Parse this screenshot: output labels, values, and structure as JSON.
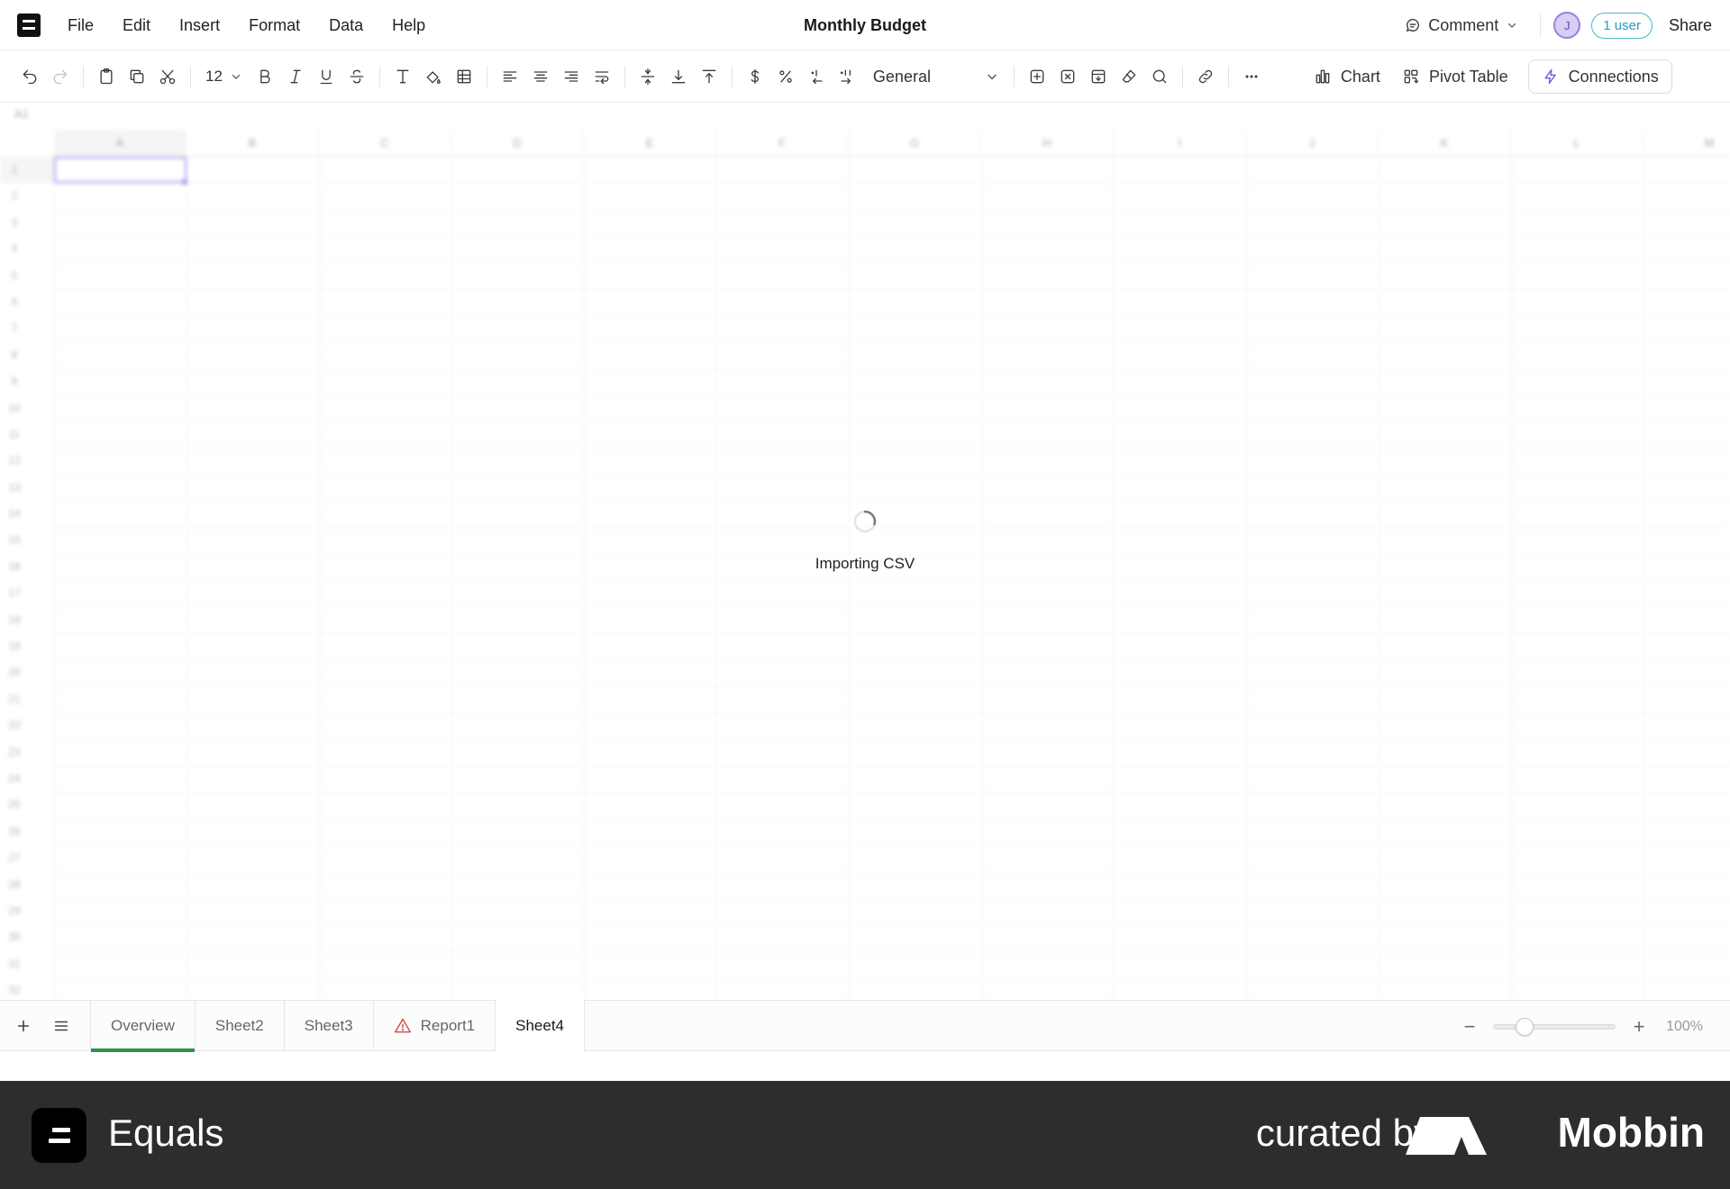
{
  "menubar": {
    "items": [
      "File",
      "Edit",
      "Insert",
      "Format",
      "Data",
      "Help"
    ],
    "doc_title": "Monthly Budget",
    "comment_label": "Comment",
    "avatar_initial": "J",
    "users_label": "1 user",
    "share_label": "Share"
  },
  "toolbar": {
    "font_size": "12",
    "number_format": "General",
    "chart_label": "Chart",
    "pivot_label": "Pivot Table",
    "connections_label": "Connections",
    "icons": [
      "undo-icon",
      "redo-icon",
      "paste-icon",
      "copy-icon",
      "cut-icon",
      "bold-icon",
      "italic-icon",
      "underline-icon",
      "strikethrough-icon",
      "text-color-icon",
      "fill-color-icon",
      "borders-icon",
      "align-left-icon",
      "align-center-icon",
      "align-right-icon",
      "wrap-icon",
      "valign-middle-icon",
      "valign-bottom-icon",
      "valign-top-icon",
      "currency-icon",
      "percent-icon",
      "decrease-decimal-icon",
      "increase-decimal-icon",
      "insert-icon",
      "delete-icon",
      "freeze-icon",
      "eraser-icon",
      "search-icon",
      "link-icon",
      "more-icon"
    ]
  },
  "grid": {
    "cell_ref": "A1",
    "columns": [
      "A",
      "B",
      "C",
      "D",
      "E",
      "F",
      "G",
      "H",
      "I",
      "J",
      "K",
      "L",
      "M"
    ],
    "rows": [
      "1",
      "2",
      "3",
      "4",
      "5",
      "6",
      "7",
      "8",
      "9",
      "10",
      "11",
      "12",
      "13",
      "14",
      "15",
      "16",
      "17",
      "18",
      "19",
      "20",
      "21",
      "22",
      "23",
      "24",
      "25",
      "26",
      "27",
      "28",
      "29",
      "30",
      "31",
      "32"
    ],
    "loading_text": "Importing CSV"
  },
  "sheets": {
    "tabs": [
      {
        "label": "Overview",
        "active": true,
        "warning": false
      },
      {
        "label": "Sheet2",
        "active": false,
        "warning": false
      },
      {
        "label": "Sheet3",
        "active": false,
        "warning": false
      },
      {
        "label": "Report1",
        "active": false,
        "warning": true
      },
      {
        "label": "Sheet4",
        "active": false,
        "warning": false
      }
    ],
    "zoom_value": "100%",
    "zoom_fraction": 0.25
  },
  "footer": {
    "brand": "Equals",
    "curated_by": "curated by",
    "curator": "Mobbin"
  },
  "colors": {
    "accent": "#8d7cf2",
    "active_tab": "#2f8f4a",
    "warning": "#d14b4b",
    "user_pill": "#2a9bc4",
    "footer_bg": "#2d2d2d"
  }
}
